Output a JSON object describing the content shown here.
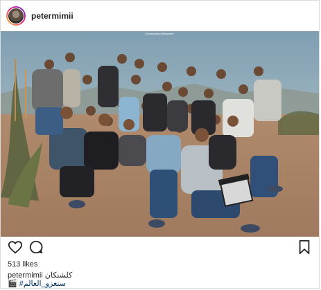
{
  "post": {
    "username": "petermimii",
    "watermark": "Cameraman Mohamed",
    "likes": "513 likes",
    "caption_user": "petermimii",
    "caption_text": "كلشنكان",
    "caption_line2": "🎬 #سنغزو_العالم"
  },
  "icons": {
    "like": "heart-icon",
    "comment": "comment-bubble-icon",
    "save": "bookmark-icon",
    "avatar": "profile-avatar"
  },
  "colors": {
    "text": "#262626",
    "border": "#dbdbdb",
    "hashtag": "#003569"
  }
}
